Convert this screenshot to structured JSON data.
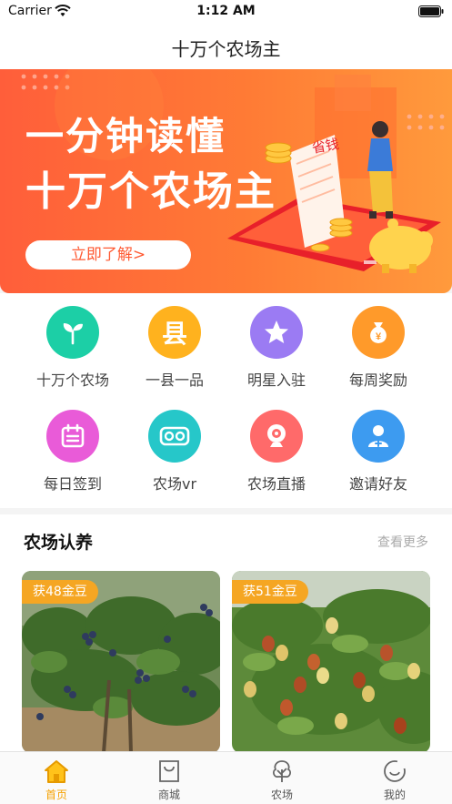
{
  "status_bar": {
    "carrier": "Carrier",
    "time": "1:12 AM"
  },
  "nav": {
    "title": "十万个农场主"
  },
  "banner": {
    "title_line1": "一分钟读懂",
    "title_line2": "十万个农场主",
    "cta": "立即了解>",
    "note_tag": "省钱"
  },
  "shortcuts": [
    {
      "label": "十万个农场",
      "icon": "sprout-icon",
      "color": "#1ccfa6"
    },
    {
      "label": "一县一品",
      "icon": "county-icon",
      "glyph": "县",
      "color": "#ffb21e"
    },
    {
      "label": "明星入驻",
      "icon": "star-icon",
      "color": "#9b7bf3"
    },
    {
      "label": "每周奖励",
      "icon": "money-bag-icon",
      "color": "#ff9a2a"
    },
    {
      "label": "每日签到",
      "icon": "calendar-icon",
      "color": "#e95bd8"
    },
    {
      "label": "农场vr",
      "icon": "vr-icon",
      "color": "#26c7c9"
    },
    {
      "label": "农场直播",
      "icon": "webcam-icon",
      "color": "#ff6a6a"
    },
    {
      "label": "邀请好友",
      "icon": "invite-user-icon",
      "color": "#3d9bf0"
    }
  ],
  "section": {
    "title": "农场认养",
    "more": "查看更多",
    "cards": [
      {
        "badge": "获48金豆",
        "subject": "blueberry-bush"
      },
      {
        "badge": "获51金豆",
        "subject": "jujube-tree"
      }
    ]
  },
  "tabbar": {
    "items": [
      {
        "label": "首页",
        "icon": "home-icon",
        "active": true
      },
      {
        "label": "商城",
        "icon": "shopping-bag-icon",
        "active": false
      },
      {
        "label": "农场",
        "icon": "tree-icon",
        "active": false
      },
      {
        "label": "我的",
        "icon": "profile-icon",
        "active": false
      }
    ],
    "active_color": "#f5a100"
  }
}
